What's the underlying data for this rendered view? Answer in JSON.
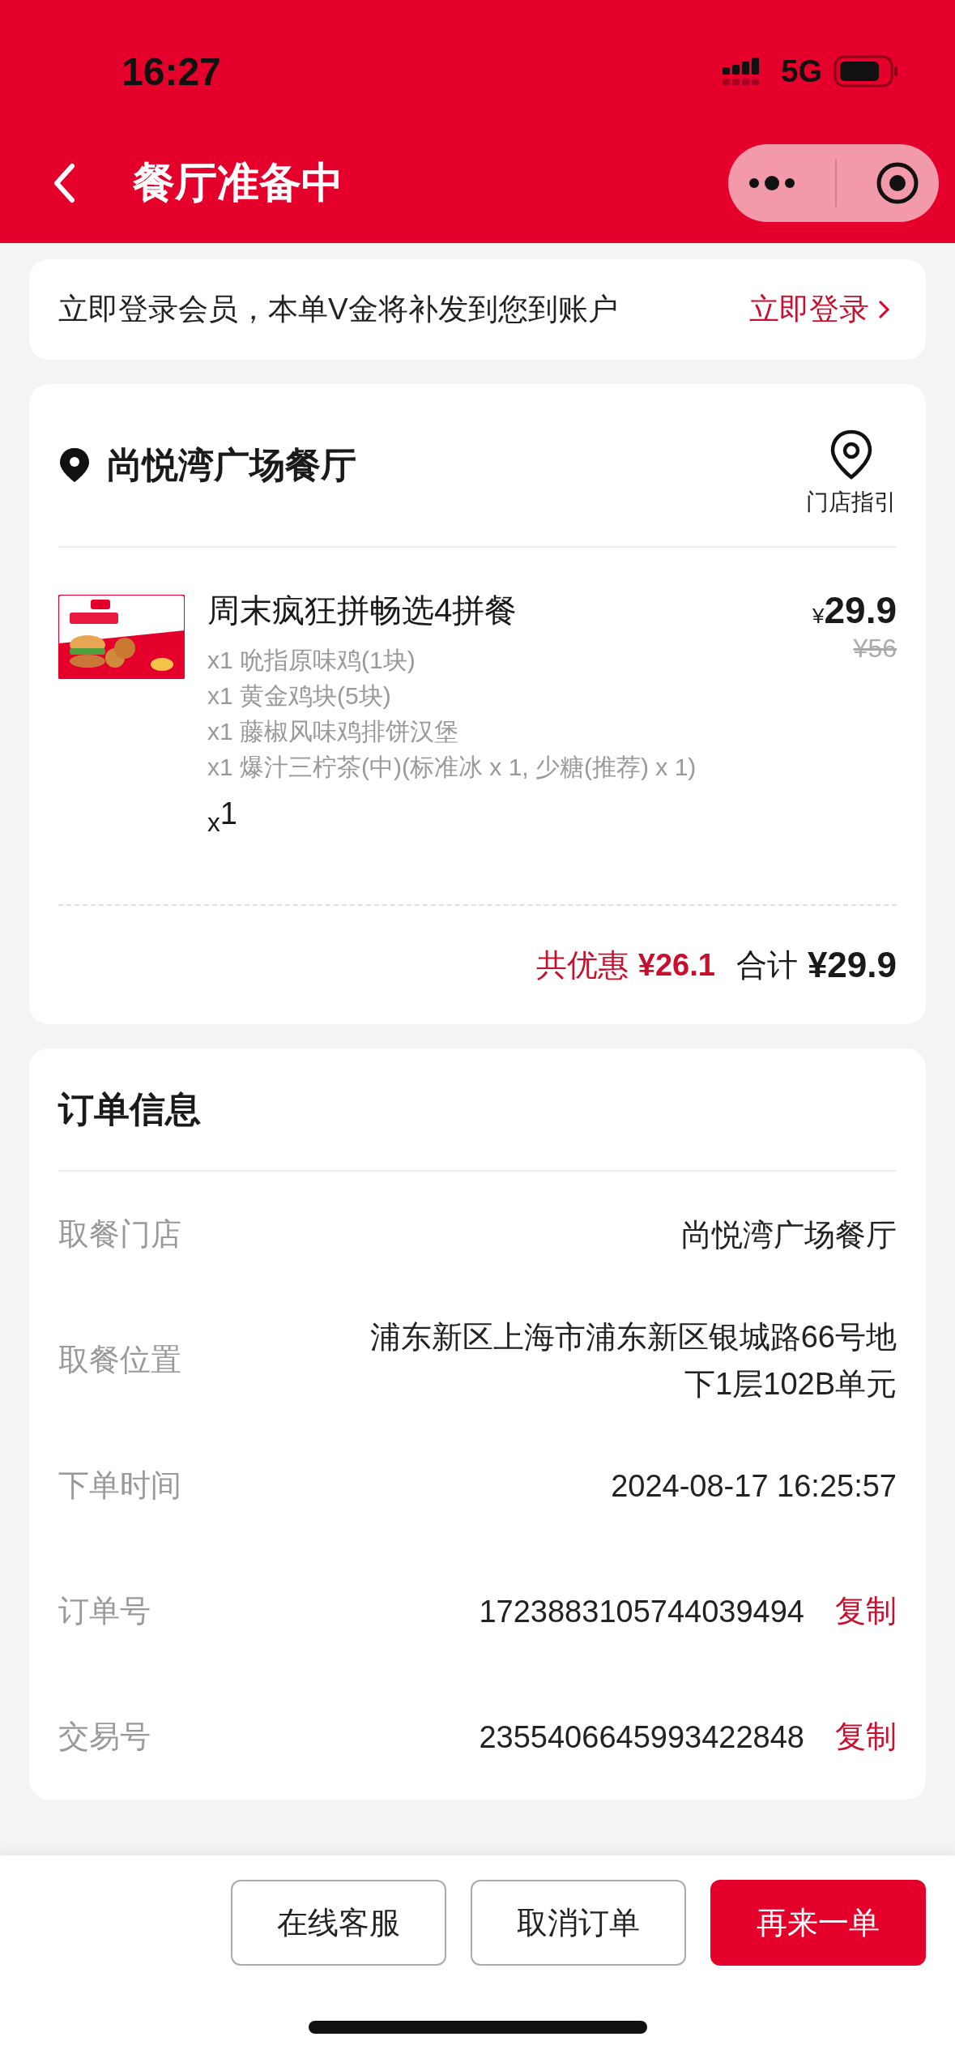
{
  "status_bar": {
    "time": "16:27",
    "network": "5G"
  },
  "header": {
    "title": "餐厅准备中"
  },
  "login_banner": {
    "text": "立即登录会员，本单V金将补发到您到账户",
    "link": "立即登录"
  },
  "store": {
    "name": "尚悦湾广场餐厅",
    "guide_label": "门店指引"
  },
  "order_item": {
    "name": "周末疯狂拼畅选4拼餐",
    "currency": "¥",
    "price": "29.9",
    "original_price": "¥56",
    "components": [
      "x1 吮指原味鸡(1块)",
      "x1 黄金鸡块(5块)",
      "x1 藤椒风味鸡排饼汉堡",
      "x1 爆汁三柠茶(中)(标准冰 x 1, 少糖(推荐) x 1)"
    ],
    "quantity": "$_{x}$1"
  },
  "totals": {
    "discount_label": "共优惠",
    "discount": "¥26.1",
    "total_label": "合计",
    "total": "¥29.9"
  },
  "order_info": {
    "title": "订单信息",
    "rows": [
      {
        "label": "取餐门店",
        "value": "尚悦湾广场餐厅"
      },
      {
        "label": "取餐位置",
        "value": "浦东新区上海市浦东新区银城路66号地下1层102B单元"
      },
      {
        "label": "下单时间",
        "value": "2024-08-17 16:25:57"
      },
      {
        "label": "订单号",
        "value": "1723883105744039494",
        "action": "复制"
      },
      {
        "label": "交易号",
        "value": "2355406645993422848",
        "action": "复制"
      }
    ]
  },
  "buttons": [
    {
      "label": "在线客服",
      "kind": "outline"
    },
    {
      "label": "取消订单",
      "kind": "outline"
    },
    {
      "label": "再来一单",
      "kind": "primary"
    }
  ]
}
